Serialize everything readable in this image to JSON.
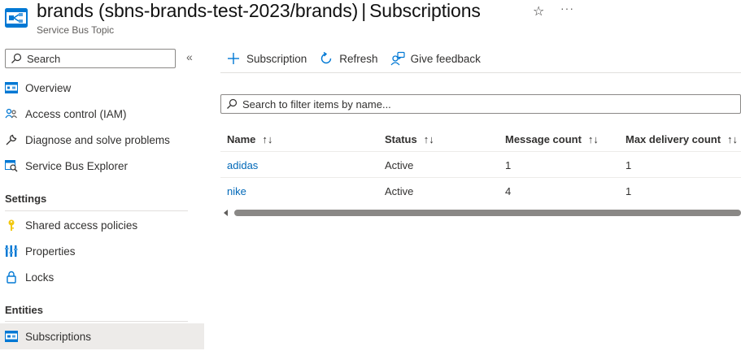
{
  "header": {
    "title_main": "brands (sbns-brands-test-2023/brands)",
    "title_separator": "|",
    "title_page": "Subscriptions",
    "subtitle": "Service Bus Topic",
    "star_icon": "star-icon",
    "more_icon": "more-icon",
    "more_glyph": "···"
  },
  "sidebar": {
    "search_placeholder": "Search",
    "collapse_glyph": "«",
    "items": [
      {
        "label": "Overview",
        "icon": "overview-icon"
      },
      {
        "label": "Access control (IAM)",
        "icon": "people-icon"
      },
      {
        "label": "Diagnose and solve problems",
        "icon": "wrench-icon"
      },
      {
        "label": "Service Bus Explorer",
        "icon": "explorer-icon"
      }
    ],
    "sections": [
      {
        "title": "Settings",
        "items": [
          {
            "label": "Shared access policies",
            "icon": "key-icon"
          },
          {
            "label": "Properties",
            "icon": "properties-icon"
          },
          {
            "label": "Locks",
            "icon": "lock-icon"
          }
        ]
      },
      {
        "title": "Entities",
        "items": [
          {
            "label": "Subscriptions",
            "icon": "subscriptions-icon",
            "selected": true
          }
        ]
      }
    ]
  },
  "toolbar": {
    "add_label": "Subscription",
    "refresh_label": "Refresh",
    "feedback_label": "Give feedback"
  },
  "filter": {
    "placeholder": "Search to filter items by name..."
  },
  "table": {
    "columns": [
      "Name",
      "Status",
      "Message count",
      "Max delivery count"
    ],
    "sort_glyph": "↑↓",
    "rows": [
      {
        "name": "adidas",
        "status": "Active",
        "message_count": "1",
        "max_delivery_count": "1"
      },
      {
        "name": "nike",
        "status": "Active",
        "message_count": "4",
        "max_delivery_count": "1"
      }
    ]
  },
  "colors": {
    "accent": "#0078d4",
    "link": "#0068b8",
    "selected_bg": "#edebe9"
  }
}
